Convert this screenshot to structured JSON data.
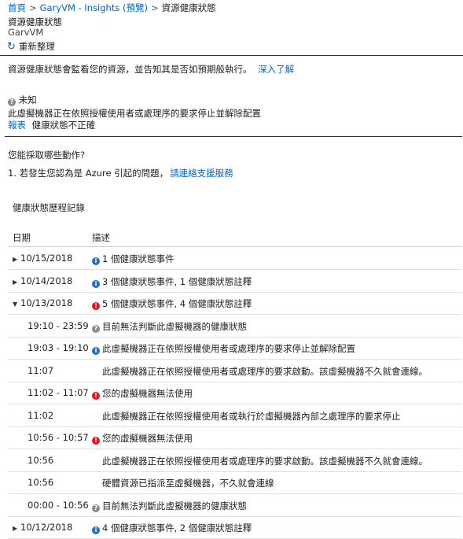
{
  "breadcrumb": {
    "home": "首頁",
    "app": "GaryVM - Insights (預覽)",
    "current": "資源健康狀態",
    "separator": ">"
  },
  "page": {
    "title": "資源健康狀態",
    "subtitle": "GarvVM"
  },
  "toolbar": {
    "refresh_label": "重新整理",
    "refresh_icon": "refresh-icon"
  },
  "intro": {
    "text": "資源健康狀態會監看您的資源，並告知其是否如預期般執行。",
    "learn_more": "深入了解"
  },
  "status": {
    "label": "未知",
    "message": "此虛擬機器正在依照授權使用者或處理序的要求停止並解除配置",
    "report_link": "報表",
    "report_text": "健康狀態不正確"
  },
  "actions": {
    "heading": "您能採取哪些動作?",
    "item_prefix": "1. 若發生您認為是 Azure 引起的問題，",
    "item_link": "請連絡支援服務"
  },
  "history": {
    "title": "健康狀態歷程記錄",
    "col_date": "日期",
    "col_desc": "描述",
    "rows": [
      {
        "date": "10/15/2018",
        "desc": "1 個健康狀態事件",
        "icon": "info",
        "kind": "day",
        "expanded": false
      },
      {
        "date": "10/14/2018",
        "desc": "3 個健康狀態事件, 1 個健康狀態註釋",
        "icon": "info",
        "kind": "day",
        "expanded": false
      },
      {
        "date": "10/13/2018",
        "desc": "5 個健康狀態事件, 4 個健康狀態註釋",
        "icon": "error",
        "kind": "day",
        "expanded": true
      },
      {
        "date": "19:10 - 23:59",
        "desc": "目前無法判斷此虛擬機器的健康狀態",
        "icon": "unknown",
        "kind": "sub"
      },
      {
        "date": "19:03 - 19:10",
        "desc": "此虛擬機器正在依照授權使用者或處理序的要求停止並解除配置",
        "icon": "info",
        "kind": "sub"
      },
      {
        "date": "11:07",
        "desc": "此虛擬機器正在依照授權使用者或處理序的要求啟動。該虛擬機器不久就會連線。",
        "icon": "",
        "kind": "sub"
      },
      {
        "date": "11:02 - 11:07",
        "desc": "您的虛擬機器無法使用",
        "icon": "error",
        "kind": "sub"
      },
      {
        "date": "11:02",
        "desc": "此虛擬機器正在依照授權使用者或執行於虛擬機器內部之處理序的要求停止",
        "icon": "",
        "kind": "sub"
      },
      {
        "date": "10:56 - 10:57",
        "desc": "您的虛擬機器無法使用",
        "icon": "error",
        "kind": "sub"
      },
      {
        "date": "10:56",
        "desc": "此虛擬機器正在依照授權使用者或處理序的要求啟動。該虛擬機器不久就會連線。",
        "icon": "",
        "kind": "sub"
      },
      {
        "date": "10:56",
        "desc": "硬體資源已指派至虛擬機器，不久就會連線",
        "icon": "",
        "kind": "sub"
      },
      {
        "date": "00:00 - 10:56",
        "desc": "目前無法判斷此虛擬機器的健康狀態",
        "icon": "unknown",
        "kind": "sub"
      },
      {
        "date": "10/12/2018",
        "desc": "4 個健康狀態事件, 2 個健康狀態註釋",
        "icon": "info",
        "kind": "day",
        "expanded": false
      }
    ]
  },
  "colors": {
    "link": "#0064c8",
    "info": "#1f6fc6",
    "error": "#e81123",
    "unknown": "#8a8a8a"
  }
}
